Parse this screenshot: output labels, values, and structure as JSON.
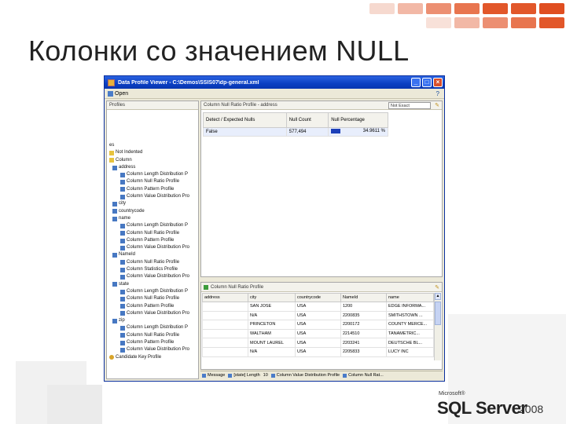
{
  "slide": {
    "title": "Колонки со значением NULL"
  },
  "colors": {
    "accent_orange": "#e2572a",
    "title_blue": "#0b3fc2"
  },
  "window": {
    "title": "Data Profile Viewer - C:\\Demos\\SSIS07\\dp-general.xml",
    "menu_open": "Open",
    "help_icon": "help-icon"
  },
  "left_pane": {
    "header": "Profiles",
    "tree": [
      "es",
      "Not Indented",
      "Column",
      "address",
      "Column Length Distribution P",
      "Column Null Ratio Profile",
      "Column Pattern Profile",
      "Column Value Distribution Pro",
      "city",
      "countrycode",
      "name",
      "Column Length Distribution P",
      "Column Null Ratio Profile",
      "Column Pattern Profile",
      "Column Value Distribution Pro",
      "NameId",
      "Column Null Ratio Profile",
      "Column Statistics Profile",
      "Column Value Distribution Pro",
      "state",
      "Column Length Distribution P",
      "Column Null Ratio Profile",
      "Column Pattern Profile",
      "Column Value Distribution Pro",
      "zip",
      "Column Length Distribution P",
      "Column Null Ratio Profile",
      "Column Pattern Profile",
      "Column Value Distribution Pro",
      "Candidate Key Profile"
    ]
  },
  "top_right": {
    "header": "Column Null Ratio Profile - address",
    "select_value": "Not Exact",
    "columns": [
      "Detect / Expected Nulls",
      "Null Count",
      "Null Percentage"
    ],
    "row": {
      "label": "False",
      "null_count": "577,494",
      "null_percentage": "34.9611 %"
    }
  },
  "bottom_right": {
    "header": "Column Null Ratio Profile",
    "columns": [
      "address",
      "city",
      "countrycode",
      "NameId",
      "name"
    ],
    "rows": [
      [
        "",
        "SAN JOSE",
        "USA",
        "1200",
        "EDGE INFORMA..."
      ],
      [
        "",
        "N/A",
        "USA",
        "2200835",
        "SMITHSTOWN ..."
      ],
      [
        "",
        "PRINCETON",
        "USA",
        "2200172",
        "COUNTY MERCE..."
      ],
      [
        "",
        "WALTHAM",
        "USA",
        "2214510",
        "TANAMETRIC..."
      ],
      [
        "",
        "MOUNT LAUREL",
        "USA",
        "2203241",
        "DEUTSCHE BL..."
      ],
      [
        "",
        "N/A",
        "USA",
        "2205833",
        "LUCY INC"
      ]
    ]
  },
  "statusbar": {
    "items": [
      "Message",
      "[state] Length",
      "10",
      "Column Value Distribution Profile",
      "Column Null Rat..."
    ]
  },
  "logo": {
    "ms": "Microsoft®",
    "product": "SQL Server",
    "year": "2008"
  }
}
